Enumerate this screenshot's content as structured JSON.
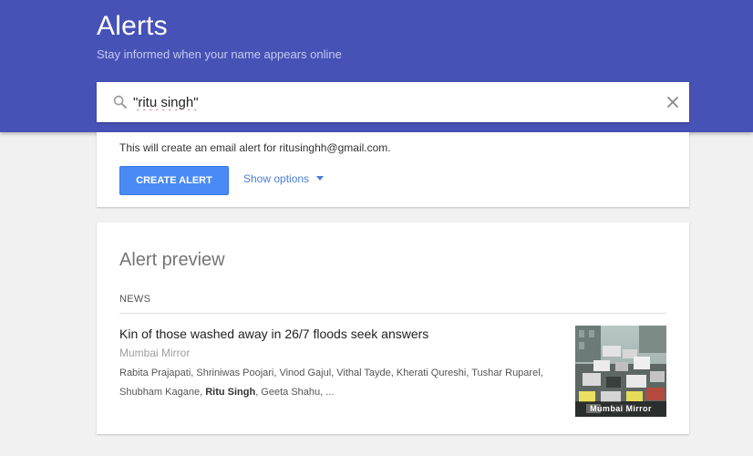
{
  "header": {
    "title": "Alerts",
    "subtitle": "Stay informed when your name appears online"
  },
  "search": {
    "value": "\"ritu singh\"",
    "icon": "search-icon",
    "clear_icon": "close-icon"
  },
  "create_alert": {
    "info": "This will create an email alert for ritusinghh@gmail.com.",
    "button_label": "CREATE ALERT",
    "options_label": "Show options"
  },
  "preview": {
    "title": "Alert preview",
    "section": "NEWS",
    "article": {
      "title": "Kin of those washed away in 26/7 floods seek answers",
      "source": "Mumbai Mirror",
      "snippet_before": "Rabita Prajapati, Shriniwas Poojari, Vinod Gajul, Vithal Tayde, Kherati Qureshi, Tushar Ruparel, Shubham Kagane, ",
      "snippet_highlight": "Ritu Singh",
      "snippet_after": ", Geeta Shahu, ...",
      "thumbnail_caption": "Mumbai Mirror"
    }
  },
  "colors": {
    "header_bg": "#4652b5",
    "button_bg": "#4a8af4",
    "link": "#4a7fd6",
    "page_bg": "#f1f1f1"
  }
}
